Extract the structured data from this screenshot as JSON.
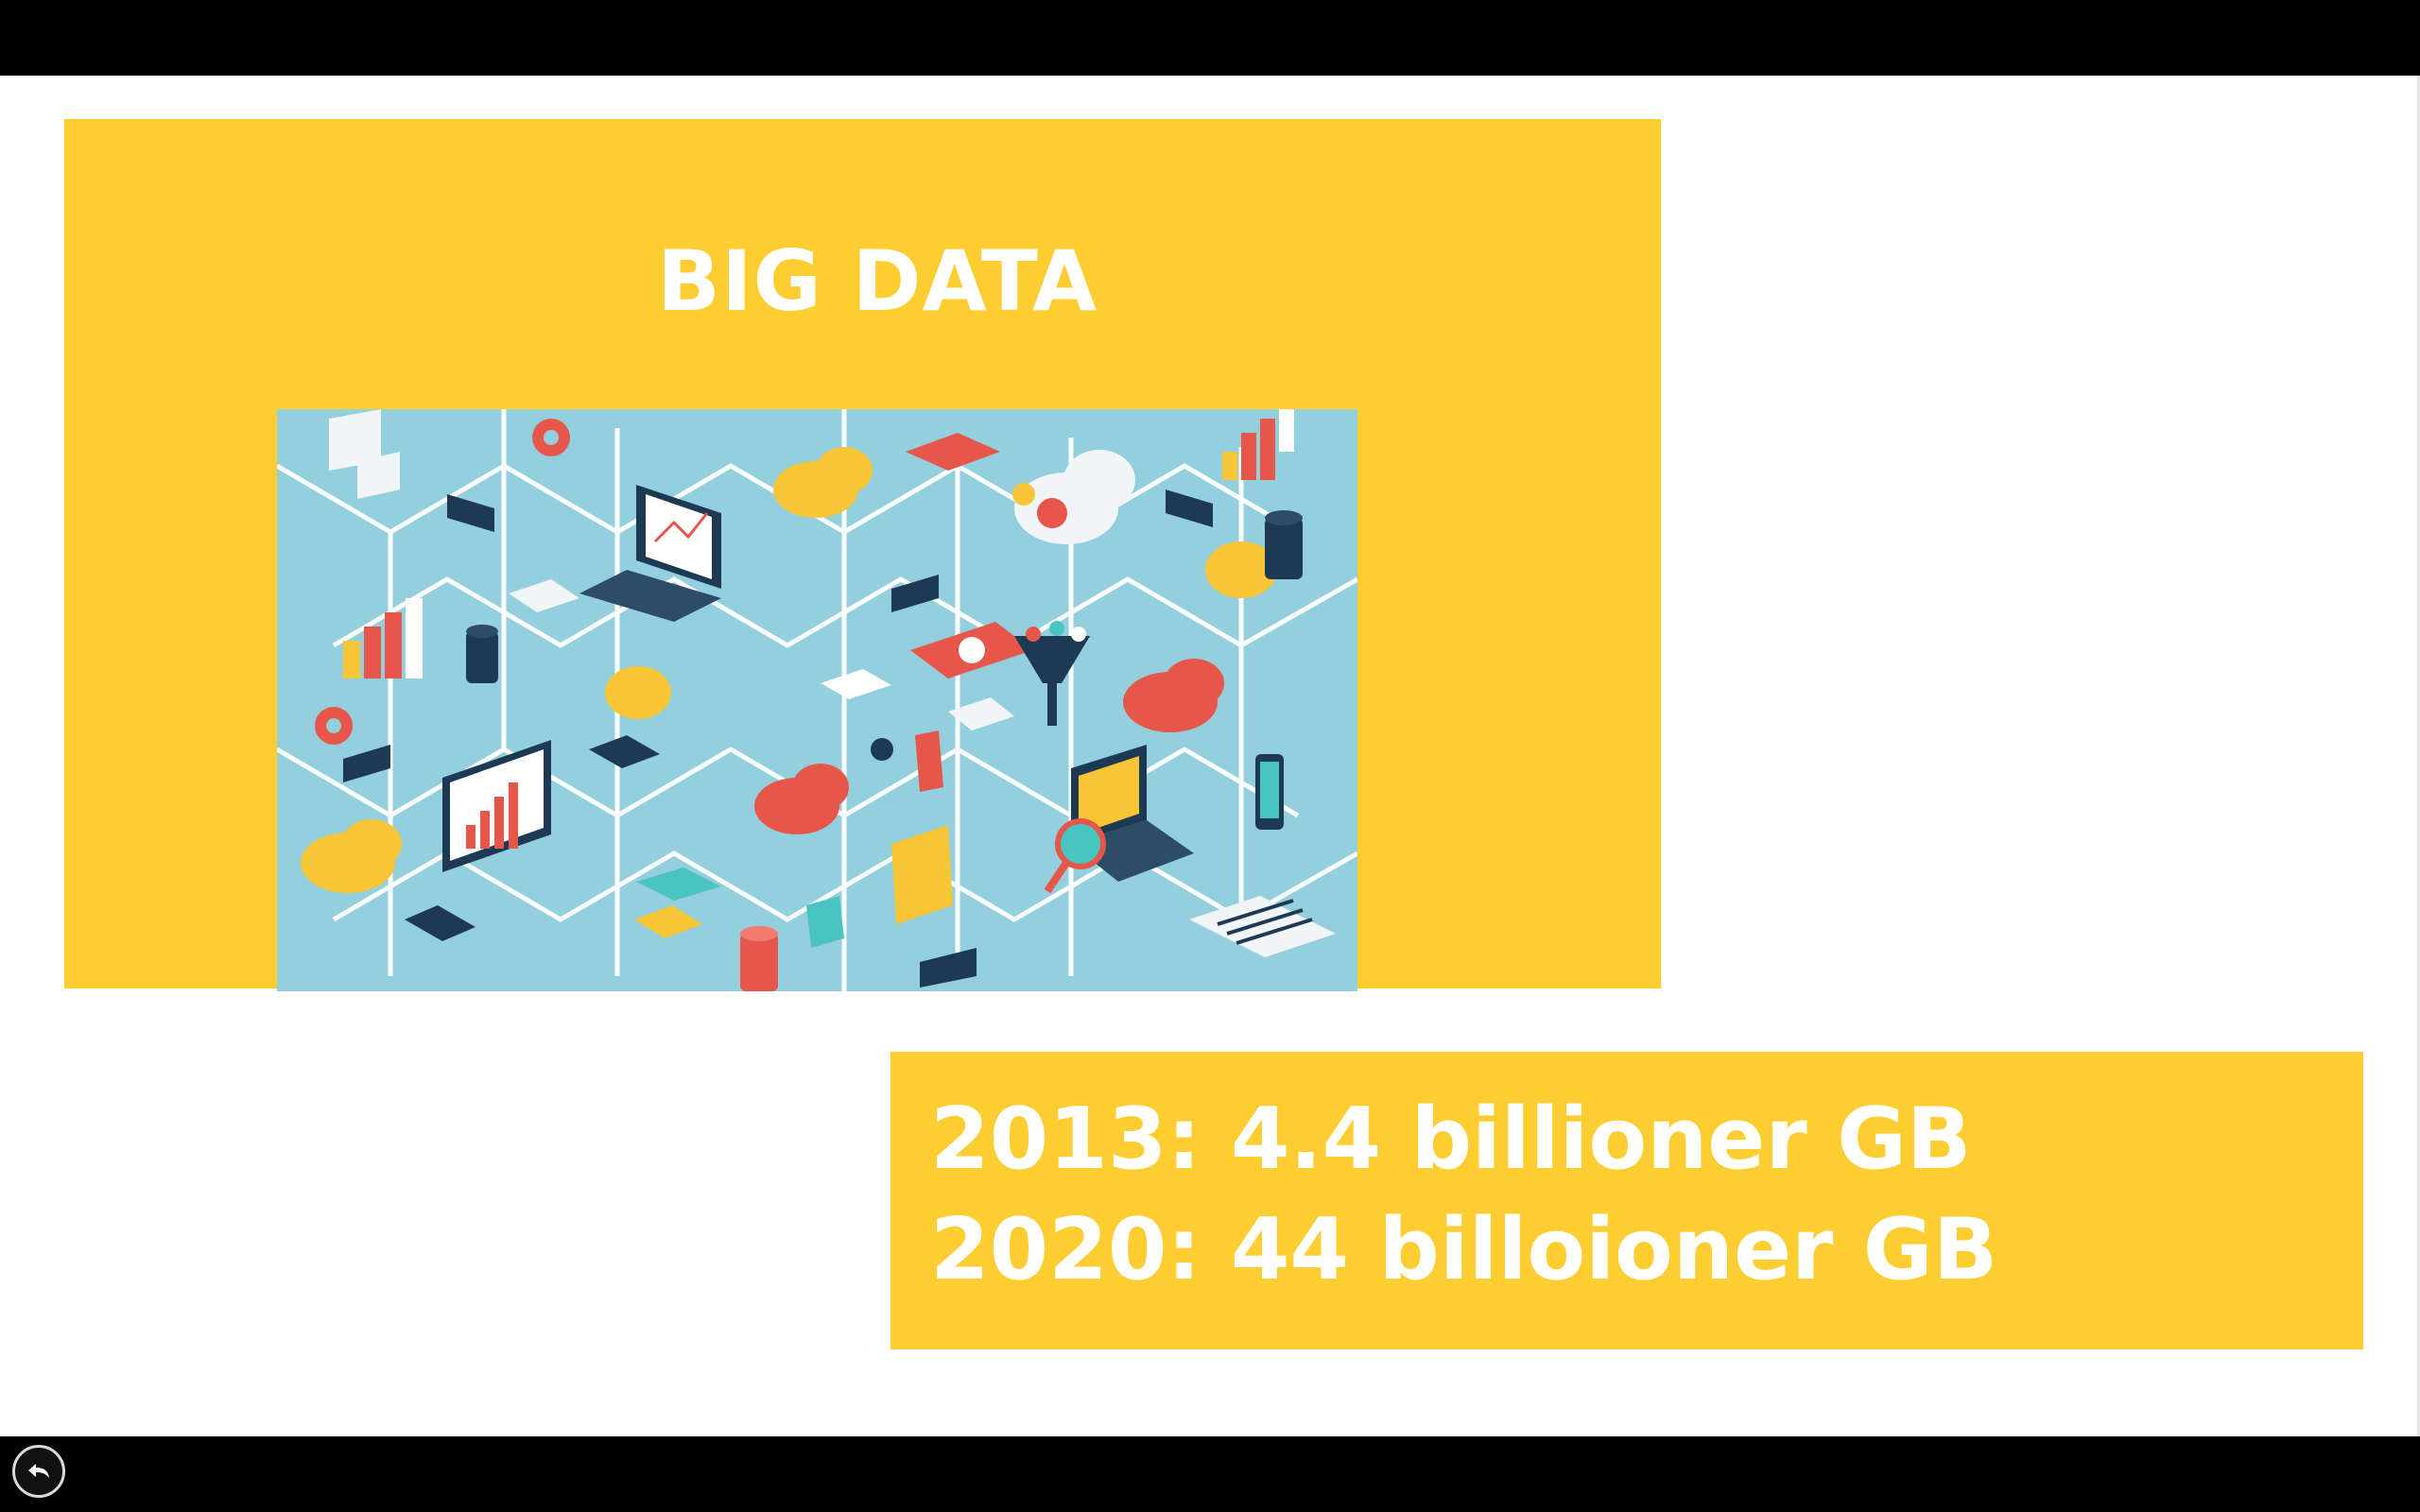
{
  "slide": {
    "title": "BIG DATA",
    "stats": [
      "2013: 4.4 billioner GB",
      "2020: 44 billoioner GB"
    ]
  },
  "illustration": {
    "icon_name": "big-data-network-illustration"
  },
  "controls": {
    "back_icon": "back-arrow-icon"
  },
  "colors": {
    "accent": "#fdcd32",
    "illustration_bg": "#93cfdc",
    "text_on_accent": "#ffffff"
  }
}
